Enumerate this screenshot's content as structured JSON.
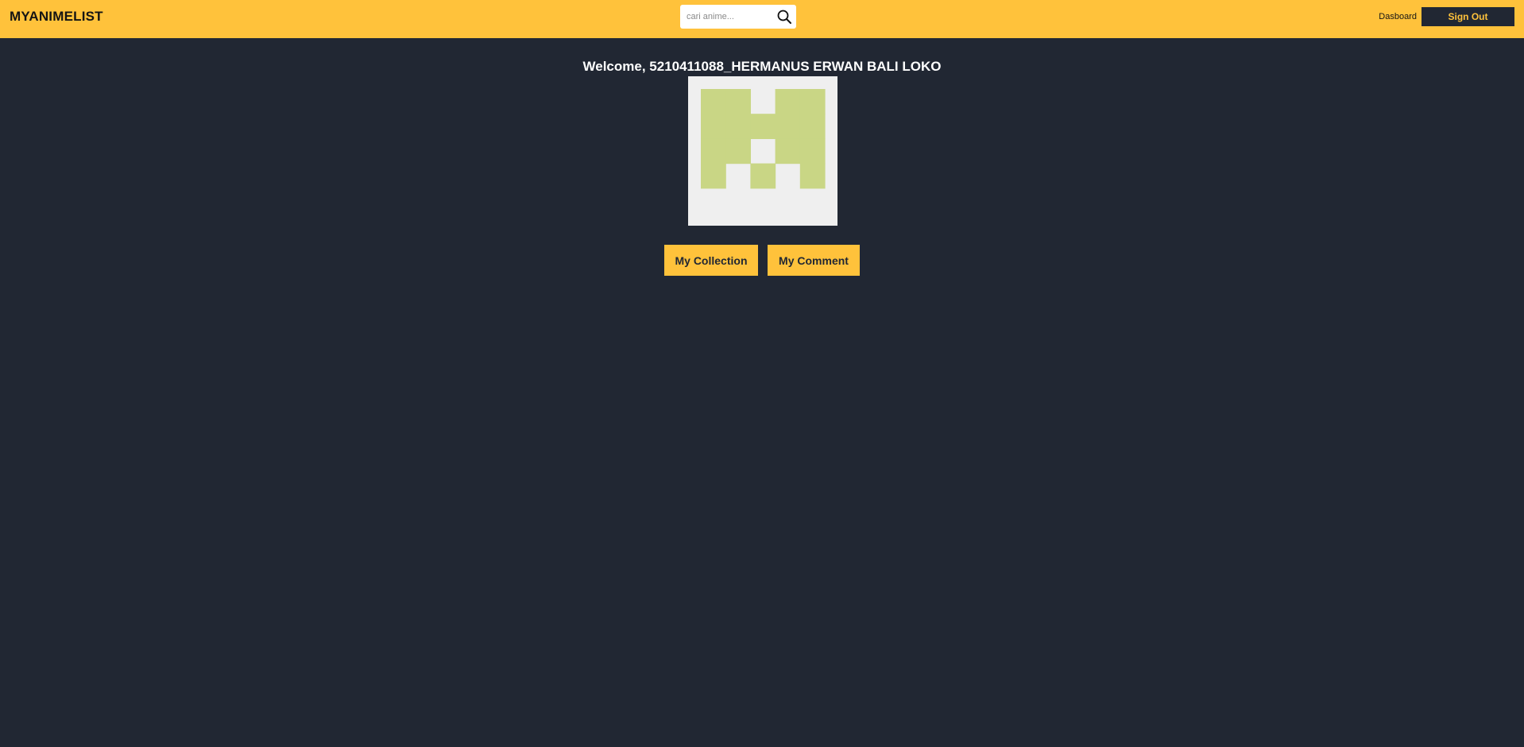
{
  "navbar": {
    "logo": "MYANIMELIST",
    "search": {
      "placeholder": "cari anime...",
      "value": "",
      "icon": "search-icon"
    },
    "dashboard_link": "Dasboard",
    "signout_label": "Sign Out"
  },
  "profile": {
    "welcome": "Welcome, 5210411088_HERMANUS ERWAN BALI LOKO",
    "avatar": {
      "type": "identicon",
      "background": "#efefef",
      "foreground": "#c9d685"
    }
  },
  "actions": {
    "collection_label": "My Collection",
    "comment_label": "My Comment"
  },
  "colors": {
    "brand": "#ffc23b",
    "background": "#212733",
    "text_dark": "#141414",
    "text_light": "#ffffff"
  }
}
